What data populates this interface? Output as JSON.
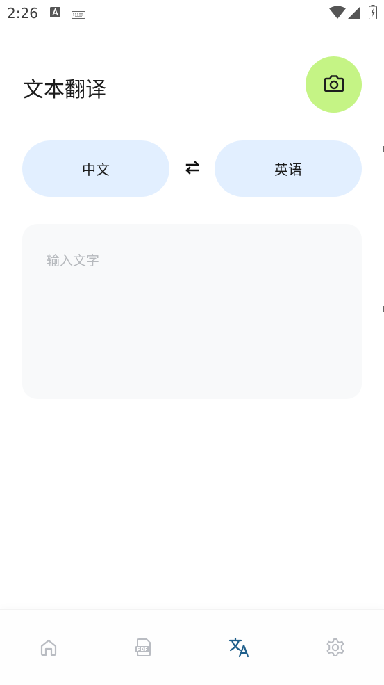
{
  "status_bar": {
    "time": "2:26"
  },
  "header": {
    "title": "文本翻译"
  },
  "icons": {
    "camera": "camera-icon",
    "swap": "swap-arrows-icon",
    "home": "home-icon",
    "pdf": "pdf-icon",
    "translate": "translate-icon",
    "settings": "gear-icon"
  },
  "languages": {
    "source": "中文",
    "target": "英语"
  },
  "input": {
    "placeholder": "输入文字",
    "value": ""
  },
  "bottom_nav": {
    "active_tab": "translate"
  },
  "colors": {
    "accent_camera": "#c5f485",
    "lang_pill": "#e2efff",
    "nav_active": "#1f5f8b",
    "nav_inactive": "#b9bcc2"
  }
}
